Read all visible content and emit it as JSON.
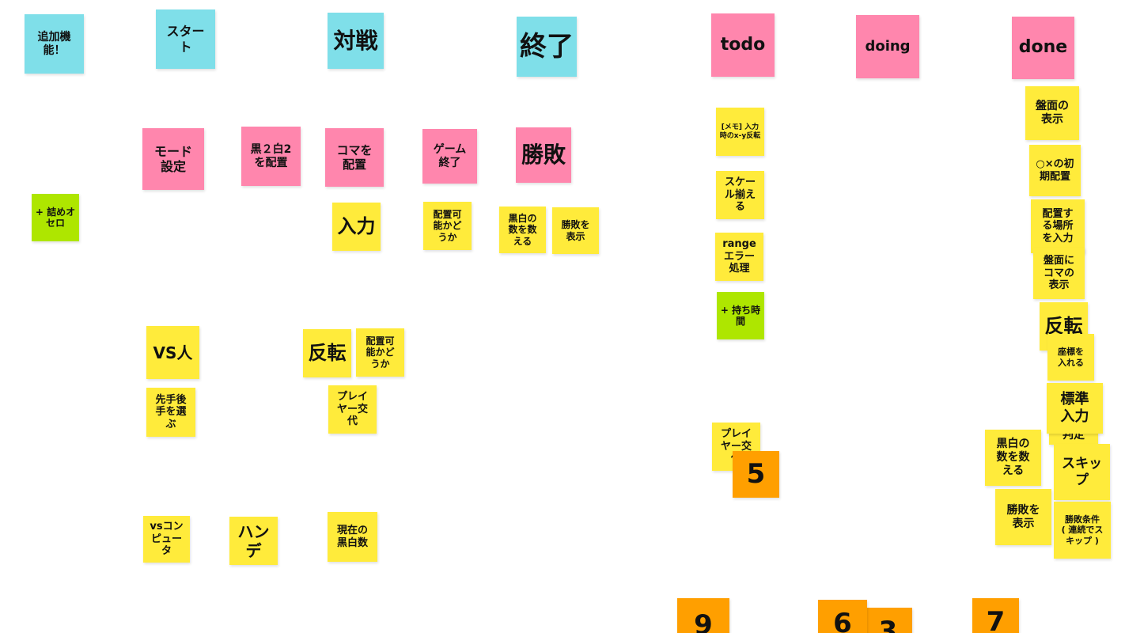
{
  "colors": {
    "cyan": "#7fdfe9",
    "pink": "#ff86ad",
    "yellow": "#ffeb3b",
    "green": "#aee600",
    "orange": "#ff9f00"
  },
  "notes": {
    "tsuika": "追加機\n能！",
    "start": "スター\nト",
    "taisen": "対戦",
    "shuryo": "終了",
    "todo": "todo",
    "doing": "doing",
    "done": "done",
    "mode": "モード\n設定",
    "kuro2shiro2": "黒２白2\nを配置",
    "koma_haichi": "コマを\n配置",
    "game_end": "ゲーム\n終了",
    "shohai": "勝敗",
    "tsume": "+ 詰めオ\nセロ",
    "nyuryoku": "入力",
    "haichi_ka1": "配置可\n能かど\nうか",
    "kokuhaku_count1": "黒白の\n数を数\nえる",
    "shohai_show1": "勝敗を\n表示",
    "vs_hito": "VS人",
    "hanten1": "反転",
    "haichi_ka2": "配置可\n能かど\nうか",
    "sente": "先手後\n手を選\nぶ",
    "player_swap1": "プレイ\nヤー交\n代",
    "vs_com": "vsコン\nピュー\nタ",
    "hande": "ハン\nデ",
    "genzai": "現在の\n黒白数",
    "memo": "[メモ] 入力\n時のx-y反転",
    "scale": "スケー\nル揃え\nる",
    "range": "range\nエラー\n処理",
    "mochi": "+ 持ち時\n間",
    "player_swap2": "プレイ\nヤー交\n代",
    "ban_show": "盤面の\n表示",
    "ox_init": "○×の初\n期配置",
    "basho": "配置す\nる場所\nを入力",
    "ban_koma": "盤面に\nコマの\n表示",
    "hanten2": "反転",
    "zahyo": "座標を\n入れる",
    "hantei": "判定",
    "hyojun": "標準\n入力",
    "kokuhaku_count2": "黒白の\n数を数\nえる",
    "skip": "スキッ\nプ",
    "shohai_show2": "勝敗を\n表示",
    "shohai_joken": "勝敗条件\n( 連続でス\nキップ )",
    "num5": "5",
    "num9": "9",
    "num6": "6",
    "num3": "3",
    "num7": "7"
  }
}
